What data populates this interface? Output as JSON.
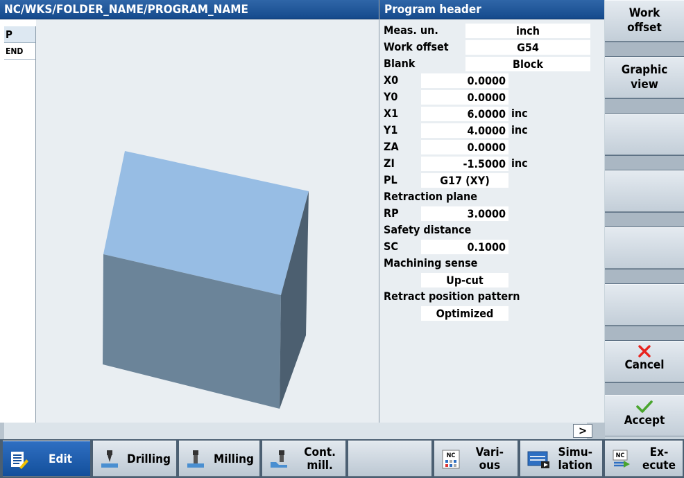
{
  "path_bar": {
    "title": "NC/WKS/FOLDER_NAME/PROGRAM_NAME"
  },
  "header_bar": {
    "title": "Program header"
  },
  "editor": {
    "items": [
      "P",
      "END"
    ]
  },
  "form": {
    "meas_unit": {
      "label": "Meas. un.",
      "value": "inch"
    },
    "work_offset": {
      "label": "Work offset",
      "value": "G54"
    },
    "blank": {
      "label": "Blank",
      "value": "Block"
    },
    "x0": {
      "label": "X0",
      "value": "0.0000"
    },
    "y0": {
      "label": "Y0",
      "value": "0.0000"
    },
    "x1": {
      "label": "X1",
      "value": "6.0000",
      "unit": "inc"
    },
    "y1": {
      "label": "Y1",
      "value": "4.0000",
      "unit": "inc"
    },
    "za": {
      "label": "ZA",
      "value": "0.0000"
    },
    "zi": {
      "label": "ZI",
      "value": "-1.5000",
      "unit": "inc"
    },
    "pl": {
      "label": "PL",
      "value": "G17 (XY)"
    },
    "retraction_plane": {
      "label": "Retraction plane"
    },
    "rp": {
      "label": "RP",
      "value": "3.0000"
    },
    "safety_distance": {
      "label": "Safety distance"
    },
    "sc": {
      "label": "SC",
      "value": "0.1000"
    },
    "machining_sense": {
      "label": "Machining sense",
      "value": "Up-cut"
    },
    "retract_pattern": {
      "label": "Retract position pattern",
      "value": "Optimized"
    }
  },
  "softkeys_right": {
    "work_offset": {
      "line1": "Work",
      "line2": "offset"
    },
    "graphic_view": {
      "line1": "Graphic",
      "line2": "view"
    },
    "cancel": {
      "label": "Cancel",
      "icon": "close-icon",
      "color": "#e8221d"
    },
    "accept": {
      "label": "Accept",
      "icon": "checkmark-icon",
      "color": "#4aa52e"
    }
  },
  "status": {
    "more_label": ">"
  },
  "softkeys_bottom": {
    "edit": {
      "label": "Edit"
    },
    "drilling": {
      "label": "Drilling"
    },
    "milling": {
      "label": "Milling"
    },
    "cont_mill": {
      "line1": "Cont.",
      "line2": "mill."
    },
    "various": {
      "line1": "Vari-",
      "line2": "ous",
      "icon_text": "NC"
    },
    "simulation": {
      "line1": "Simu-",
      "line2": "lation"
    },
    "execute": {
      "line1": "Ex-",
      "line2": "ecute",
      "icon_text": "NC"
    }
  },
  "colors": {
    "title_bar": "#1b5296",
    "block_top": "#97bde4",
    "block_front": "#6b8499",
    "block_side": "#4c5f70",
    "active_softkey": "#1f5fae"
  }
}
